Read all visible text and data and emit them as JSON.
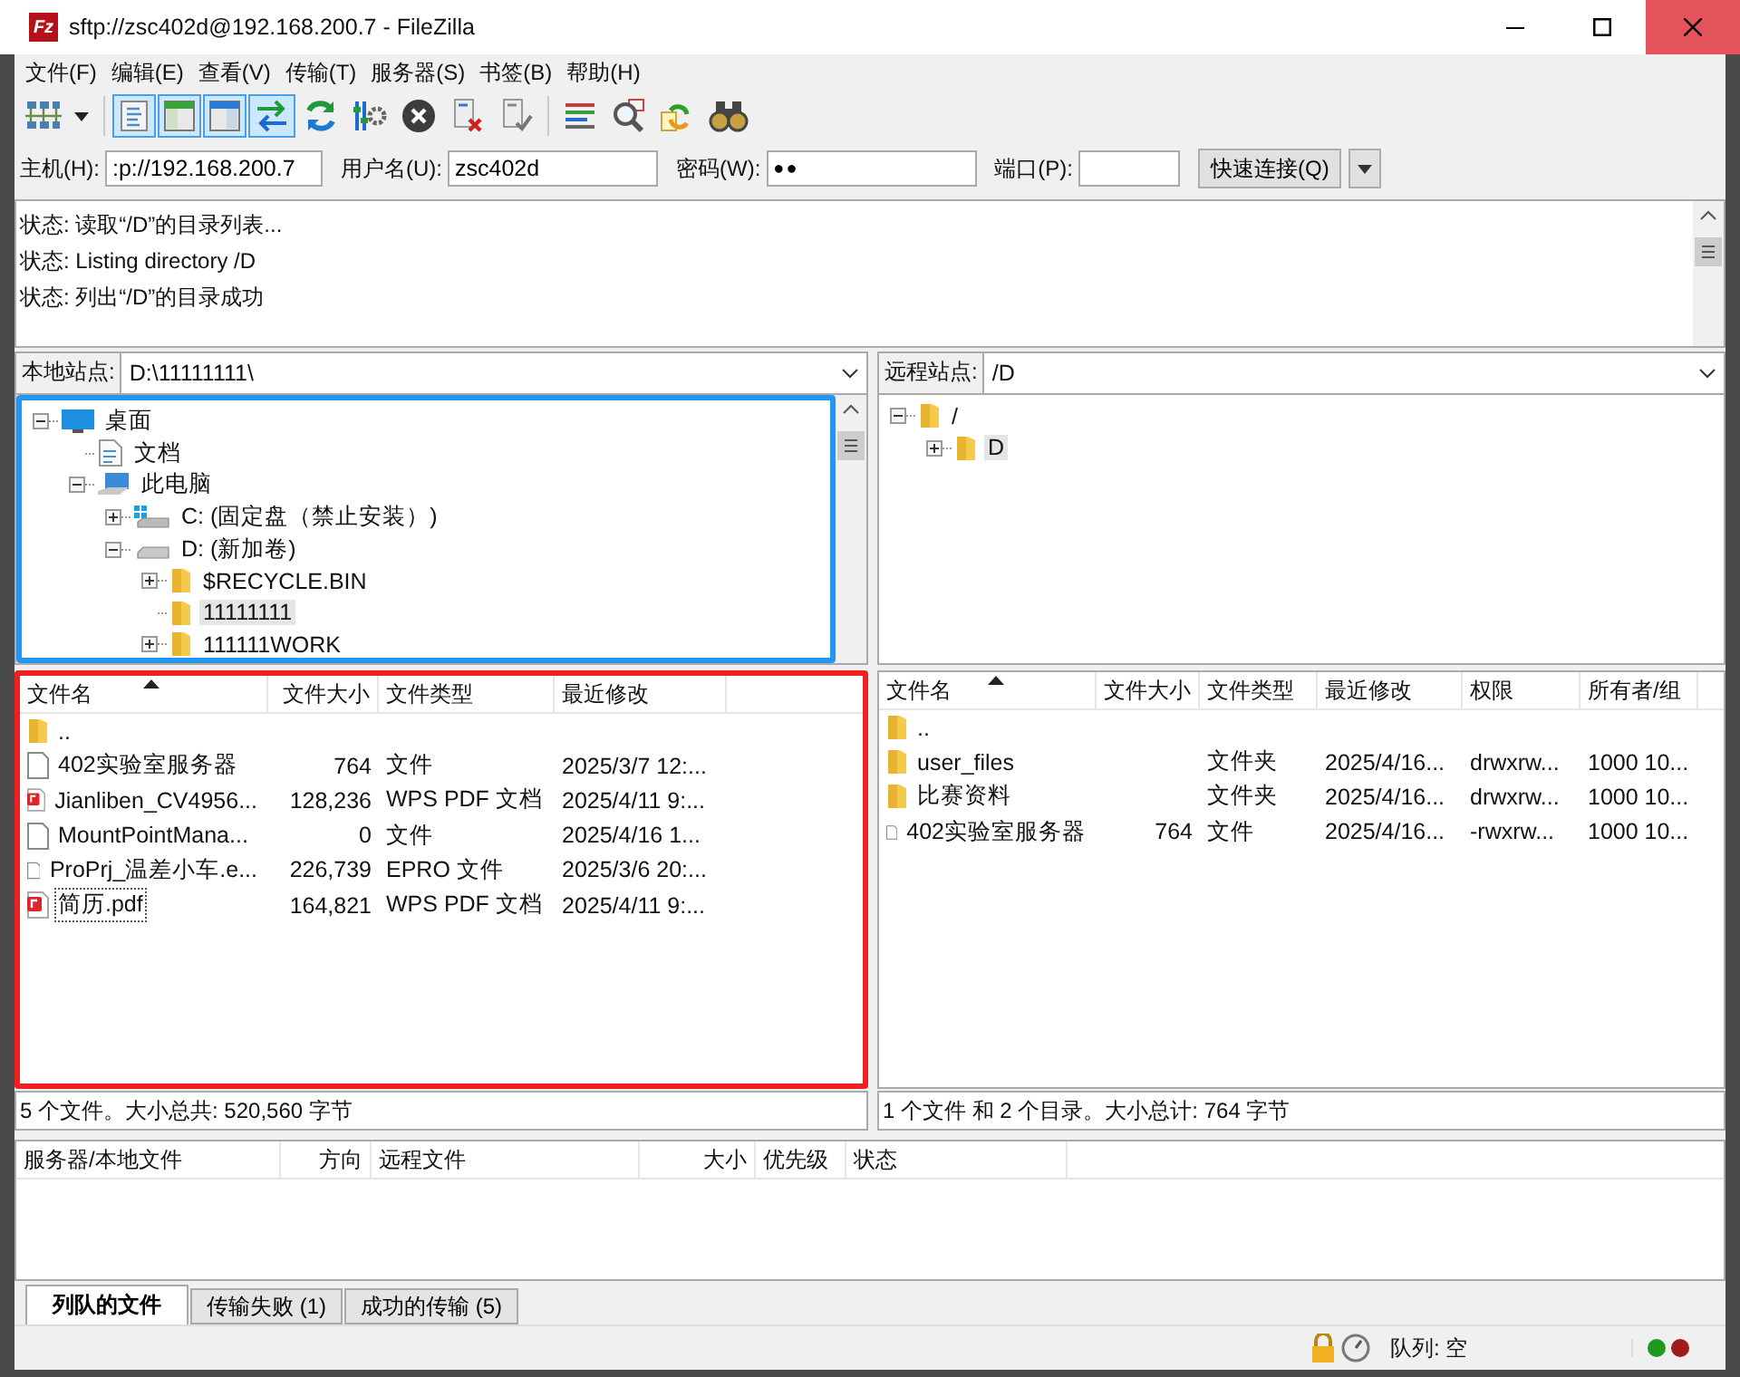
{
  "window": {
    "icon_text": "Fz",
    "title": "sftp://zsc402d@192.168.200.7 - FileZilla"
  },
  "menu": [
    "文件(F)",
    "编辑(E)",
    "查看(V)",
    "传输(T)",
    "服务器(S)",
    "书签(B)",
    "帮助(H)"
  ],
  "toolbar": [
    {
      "kind": "site_manager",
      "pressed": false
    },
    {
      "kind": "log",
      "pressed": true
    },
    {
      "kind": "local_tree",
      "pressed": true
    },
    {
      "kind": "remote_tree",
      "pressed": true
    },
    {
      "kind": "queue",
      "pressed": true
    },
    {
      "kind": "refresh",
      "pressed": false
    },
    {
      "kind": "process_queue",
      "pressed": false
    },
    {
      "kind": "cancel",
      "pressed": false
    },
    {
      "kind": "disconnect",
      "pressed": false
    },
    {
      "kind": "reconnect",
      "pressed": false
    },
    {
      "kind": "filter",
      "pressed": false
    },
    {
      "kind": "compare",
      "pressed": false
    },
    {
      "kind": "sync",
      "pressed": false
    },
    {
      "kind": "search",
      "pressed": false
    }
  ],
  "quickconnect": {
    "host_label": "主机(H):",
    "host": ":p://192.168.200.7",
    "user_label": "用户名(U):",
    "user": "zsc402d",
    "password_label": "密码(W):",
    "password": "●●",
    "port_label": "端口(P):",
    "button": "快速连接(Q)"
  },
  "log": [
    "状态: 读取“/D”的目录列表...",
    "状态: Listing directory /D",
    "状态: 列出“/D”的目录成功"
  ],
  "local": {
    "site_label": "本地站点:",
    "path": "D:\\11111111\\",
    "tree": [
      {
        "label": "桌面",
        "kind": "desktop",
        "expanded": true,
        "selected": false,
        "children": [
          {
            "label": "文档",
            "kind": "document",
            "selected": false
          },
          {
            "label": "此电脑",
            "kind": "computer",
            "expanded": true,
            "selected": false,
            "children": [
              {
                "label": "C: (固定盘（禁止安装）)",
                "kind": "system_drive",
                "expanded": false,
                "selected": false
              },
              {
                "label": "D: (新加卷)",
                "kind": "drive",
                "expanded": true,
                "selected": false,
                "children": [
                  {
                    "label": "$RECYCLE.BIN",
                    "kind": "folder",
                    "expanded": false,
                    "selected": false
                  },
                  {
                    "label": "11111111",
                    "kind": "folder",
                    "selected": true
                  },
                  {
                    "label": "111111WORK",
                    "kind": "folder",
                    "expanded": false,
                    "selected": false
                  }
                ]
              }
            ]
          }
        ]
      }
    ],
    "columns": [
      {
        "label": "文件名",
        "sorted": true,
        "kind": "text"
      },
      {
        "label": "文件大小",
        "sorted": false,
        "kind": "number"
      },
      {
        "label": "文件类型",
        "sorted": false,
        "kind": "text"
      },
      {
        "label": "最近修改",
        "sorted": false,
        "kind": "text"
      }
    ],
    "rows": [
      {
        "kind": "folder",
        "cells": [
          ".."
        ],
        "focused": false
      },
      {
        "kind": "file",
        "cells": [
          "402实验室服务器",
          "764",
          "文件",
          "2025/3/7 12:..."
        ],
        "focused": false
      },
      {
        "kind": "pdf",
        "cells": [
          "Jianliben_CV4956...",
          "128,236",
          "WPS PDF 文档",
          "2025/4/11 9:..."
        ],
        "focused": false
      },
      {
        "kind": "file",
        "cells": [
          "MountPointMana...",
          "0",
          "文件",
          "2025/4/16 1..."
        ],
        "focused": false
      },
      {
        "kind": "file",
        "cells": [
          "ProPrj_温差小车.e...",
          "226,739",
          "EPRO 文件",
          "2025/3/6 20:..."
        ],
        "focused": false
      },
      {
        "kind": "pdf",
        "cells": [
          "简历.pdf",
          "164,821",
          "WPS PDF 文档",
          "2025/4/11 9:..."
        ],
        "focused": true
      }
    ],
    "status": "5 个文件。大小总共: 520,560 字节"
  },
  "remote": {
    "site_label": "远程站点:",
    "path": "/D",
    "tree": [
      {
        "label": "/",
        "kind": "folder",
        "expanded": true,
        "selected": false,
        "children": [
          {
            "label": "D",
            "kind": "folder",
            "expanded": false,
            "selected": true
          }
        ]
      }
    ],
    "columns": [
      {
        "label": "文件名",
        "sorted": true,
        "kind": "text"
      },
      {
        "label": "文件大小",
        "sorted": false,
        "kind": "number"
      },
      {
        "label": "文件类型",
        "sorted": false,
        "kind": "text"
      },
      {
        "label": "最近修改",
        "sorted": false,
        "kind": "text"
      },
      {
        "label": "权限",
        "sorted": false,
        "kind": "text"
      },
      {
        "label": "所有者/组",
        "sorted": false,
        "kind": "text"
      }
    ],
    "rows": [
      {
        "kind": "folder",
        "cells": [
          ".."
        ],
        "focused": false
      },
      {
        "kind": "folder",
        "cells": [
          "user_files",
          null,
          "文件夹",
          "2025/4/16...",
          "drwxrw...",
          "1000 10..."
        ],
        "focused": false
      },
      {
        "kind": "folder",
        "cells": [
          "比赛资料",
          null,
          "文件夹",
          "2025/4/16...",
          "drwxrw...",
          "1000 10..."
        ],
        "focused": false
      },
      {
        "kind": "file",
        "cells": [
          "402实验室服务器",
          "764",
          "文件",
          "2025/4/16...",
          "-rwxrw...",
          "1000 10..."
        ],
        "focused": false
      }
    ],
    "status": "1 个文件 和 2 个目录。大小总计: 764 字节"
  },
  "queue": {
    "columns": [
      {
        "label": "服务器/本地文件",
        "kind": "text"
      },
      {
        "label": "方向",
        "kind": "number"
      },
      {
        "label": "远程文件",
        "kind": "text"
      },
      {
        "label": "大小",
        "kind": "number"
      },
      {
        "label": "优先级",
        "kind": "text"
      },
      {
        "label": "状态",
        "kind": "text"
      }
    ]
  },
  "queue_tabs": [
    {
      "label": "列队的文件",
      "selected": true
    },
    {
      "label": "传输失败 (1)",
      "selected": false
    },
    {
      "label": "成功的传输 (5)",
      "selected": false
    }
  ],
  "status_bar": {
    "queue": "队列: 空",
    "lights": [
      {
        "color": "#1f9a1f"
      },
      {
        "color": "#a11b1b"
      }
    ]
  },
  "annotations": {
    "local_tree": {
      "color": "#2196f3"
    },
    "local_list": {
      "color": "#f02020"
    }
  }
}
